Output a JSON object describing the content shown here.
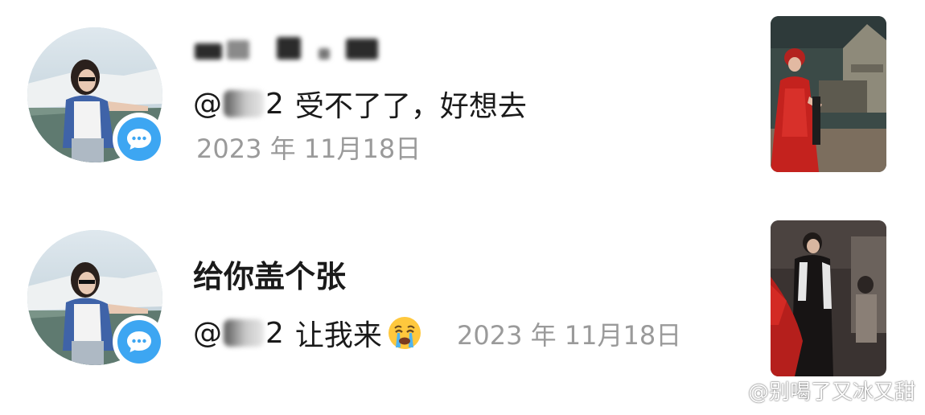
{
  "notifications": [
    {
      "username_redacted": true,
      "reply_text": "受不了了，好想去",
      "mention_prefix": "@",
      "mention_suffix": "2",
      "date": "2023 年 11月18日"
    },
    {
      "comment_text": "给你盖个张",
      "mention_prefix": "@",
      "mention_suffix": "2",
      "reply_text": "让我来",
      "emoji": "crying-face",
      "date": "2023 年 11月18日"
    }
  ],
  "watermark": {
    "text": "@别喝了又冰又甜"
  },
  "colors": {
    "badge": "#3da6f2",
    "date_gray": "#9a9a9a",
    "text": "#1a1a1a"
  }
}
